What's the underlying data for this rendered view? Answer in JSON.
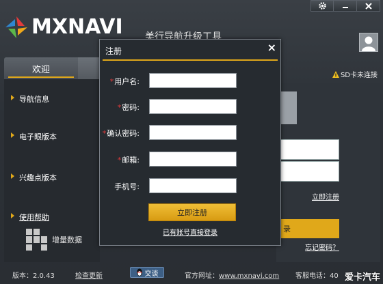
{
  "app": {
    "brand": "MXNAVI",
    "tagline": "美行导航升级工具",
    "brand_colors": {
      "accent": "#e0a81a",
      "background": "#2c3137"
    }
  },
  "titlebar": {
    "settings_icon": "gear-icon",
    "minimize_icon": "minimize-icon",
    "close_icon": "close-icon"
  },
  "tabs": [
    {
      "label": "欢迎"
    }
  ],
  "status": {
    "sd": "SD卡未连接"
  },
  "sidebar": {
    "items": [
      {
        "label": "导航信息"
      },
      {
        "label": "电子眼版本"
      },
      {
        "label": "兴趣点版本"
      },
      {
        "label": "使用帮助"
      },
      {
        "label": "增量数据"
      }
    ]
  },
  "login_panel": {
    "register_link": "立即注册",
    "login_button": "录",
    "forgot_link": "忘记密码？"
  },
  "modal": {
    "title": "注册",
    "close": "×",
    "fields": [
      {
        "label": "用户名:",
        "required": true,
        "value": ""
      },
      {
        "label": "密码:",
        "required": true,
        "value": ""
      },
      {
        "label": "确认密码:",
        "required": true,
        "value": ""
      },
      {
        "label": "邮箱:",
        "required": true,
        "value": ""
      },
      {
        "label": "手机号:",
        "required": false,
        "value": ""
      }
    ],
    "required_mark": "*",
    "submit": "立即注册",
    "login_link": "已有账号直接登录"
  },
  "footer": {
    "version": "版本：2.0.43",
    "check_update": "检查更新",
    "qq": "交谈",
    "site_label": "官方网址：",
    "site_url": "www.mxnavi.com",
    "phone": "客服电话：40"
  },
  "watermark": "爱卡汽车"
}
